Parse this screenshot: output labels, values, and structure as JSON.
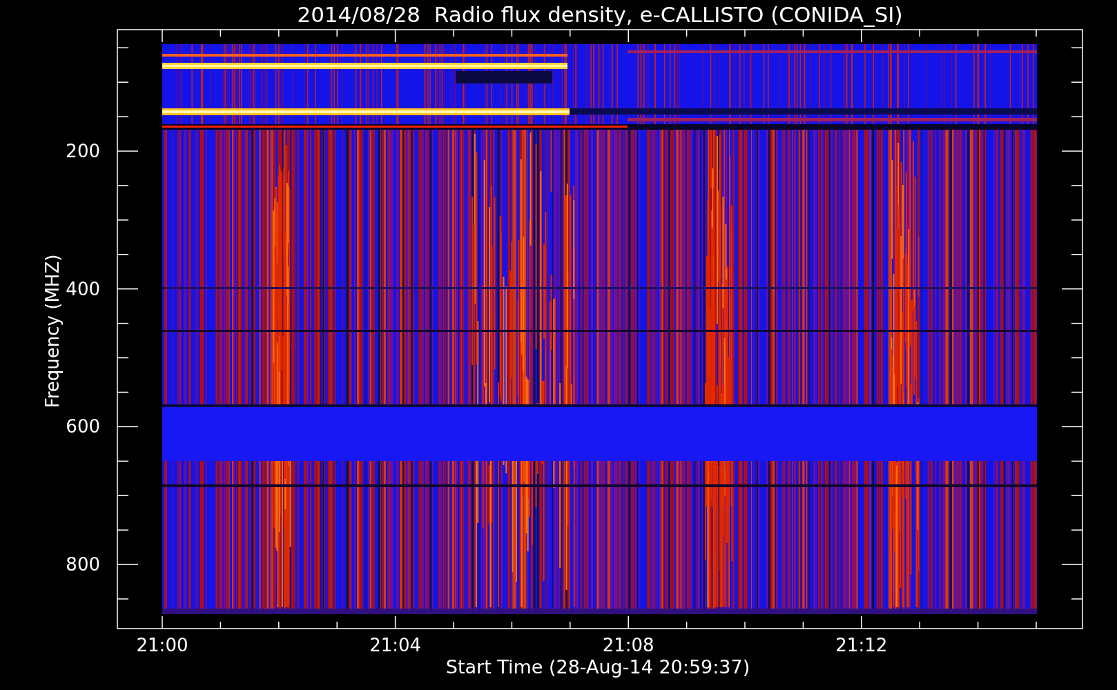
{
  "plot": {
    "title": "2014/08/28  Radio flux density, e-CALLISTO (CONIDA_SI)",
    "xlabel": "Start Time (28-Aug-14 20:59:37)",
    "ylabel": "Frequency (MHZ)",
    "xticks": [
      "21:00",
      "21:04",
      "21:08",
      "21:12"
    ],
    "yticks": [
      "200",
      "400",
      "600",
      "800"
    ]
  }
}
